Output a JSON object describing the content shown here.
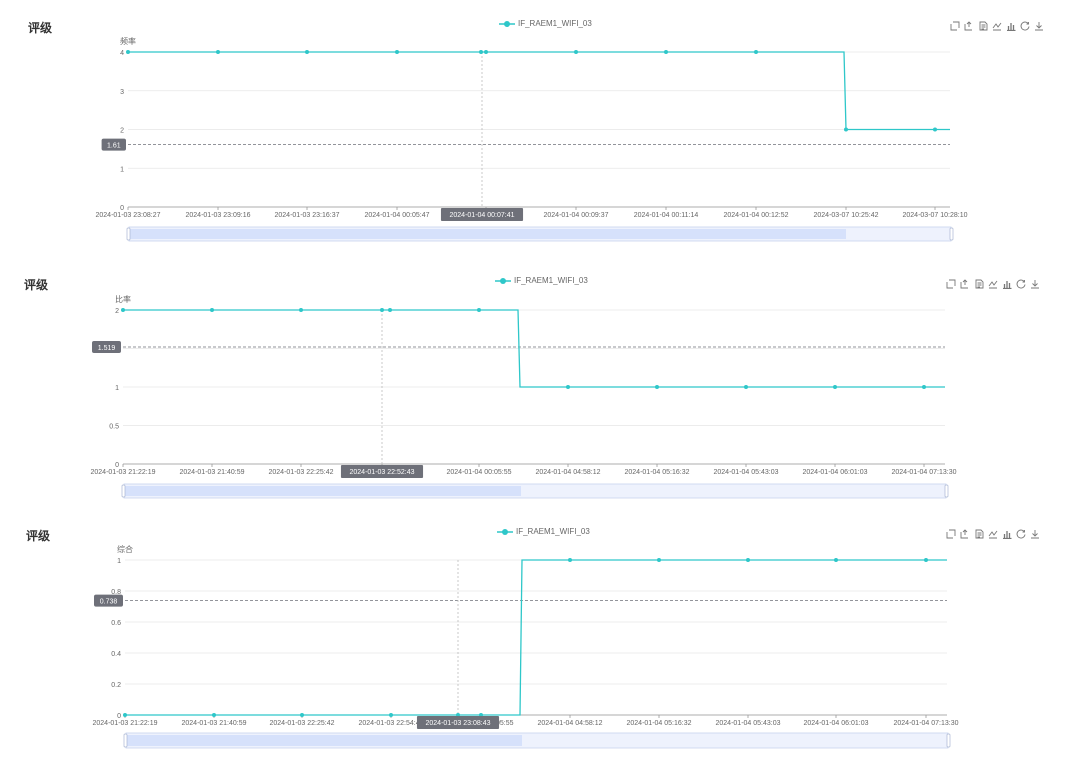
{
  "charts": [
    {
      "title": "评级",
      "legend": "IF_RAEM1_WIFI_03",
      "chart_data": {
        "type": "line",
        "ylabel": "频率",
        "ylim": [
          0,
          4
        ],
        "yticks": [
          "0",
          "1",
          "2",
          "3",
          "4"
        ],
        "x": [
          "2024-01-03 23:08:27",
          "2024-01-03 23:09:16",
          "2024-01-03 23:16:37",
          "2024-01-04 00:05:47",
          "2024-01-04 00:07:41",
          "2024-01-04 00:09:37",
          "2024-01-04 00:11:14",
          "2024-01-04 00:12:52",
          "2024-03-07 10:25:42",
          "2024-03-07 10:28:10"
        ],
        "series": [
          {
            "name": "IF_RAEM1_WIFI_03",
            "values": [
              4,
              4,
              4,
              4,
              4,
              4,
              4,
              4,
              2,
              2
            ]
          }
        ],
        "extra_points": [
          {
            "y": 4
          }
        ],
        "markline": {
          "value": 1.61,
          "label": "1.61"
        },
        "tooltip_x_label": "2024-01-04 00:07:41",
        "grid": true,
        "legend_position": "top-center"
      }
    },
    {
      "title": "评级",
      "legend": "IF_RAEM1_WIFI_03",
      "chart_data": {
        "type": "line",
        "ylabel": "比率",
        "ylim": [
          0,
          2
        ],
        "yticks": [
          "0",
          "0.5",
          "1",
          "1.5",
          "2"
        ],
        "x": [
          "2024-01-03 21:22:19",
          "2024-01-03 21:40:59",
          "2024-01-03 22:25:42",
          "2024-01-03 22:52:43",
          "2024-01-04 00:05:55",
          "2024-01-04 04:58:12",
          "2024-01-04 05:16:32",
          "2024-01-04 05:43:03",
          "2024-01-04 06:01:03",
          "2024-01-04 07:13:30"
        ],
        "series": [
          {
            "name": "IF_RAEM1_WIFI_03",
            "values": [
              2,
              2,
              2,
              2,
              2,
              1,
              1,
              1,
              1,
              1
            ]
          }
        ],
        "extra_points": [
          {
            "y": 2
          }
        ],
        "markline": {
          "value": 1.519,
          "label": "1.519"
        },
        "tooltip_x_label": "2024-01-03 22:52:43",
        "grid": true,
        "legend_position": "top-center"
      }
    },
    {
      "title": "评级",
      "legend": "IF_RAEM1_WIFI_03",
      "chart_data": {
        "type": "line",
        "ylabel": "综合",
        "ylim": [
          0,
          1
        ],
        "yticks": [
          "0",
          "0.2",
          "0.4",
          "0.6",
          "0.8",
          "1"
        ],
        "x": [
          "2024-01-03 21:22:19",
          "2024-01-03 21:40:59",
          "2024-01-03 22:25:42",
          "2024-01-03 22:54:42",
          "2024-01-03 23:08:43",
          "2024-01-04 00:05:55",
          "2024-01-04 04:58:12",
          "2024-01-04 05:16:32",
          "2024-01-04 05:43:03",
          "2024-01-04 06:01:03",
          "2024-01-04 07:13:30"
        ],
        "series": [
          {
            "name": "IF_RAEM1_WIFI_03",
            "values": [
              0,
              0,
              0,
              0,
              0,
              0,
              1,
              1,
              1,
              1,
              1
            ]
          }
        ],
        "extra_points": [],
        "markline": {
          "value": 0.738,
          "label": "0.738"
        },
        "tooltip_x_label": "2024-01-03 23:08:43",
        "grid": true,
        "legend_position": "top-center"
      }
    }
  ],
  "toolbox_icons": [
    "zoom-select-icon",
    "zoom-reset-icon",
    "data-view-icon",
    "line-chart-icon",
    "bar-chart-icon",
    "restore-icon",
    "download-icon"
  ],
  "colors": {
    "series": "#2ec7c9",
    "grid": "#e6e6e6",
    "axis": "#999999",
    "markline": "#6e7079",
    "tooltip_bg": "#6e7079",
    "zoom_fill": "#d6e1fb",
    "zoom_border": "#c8d3ee"
  }
}
